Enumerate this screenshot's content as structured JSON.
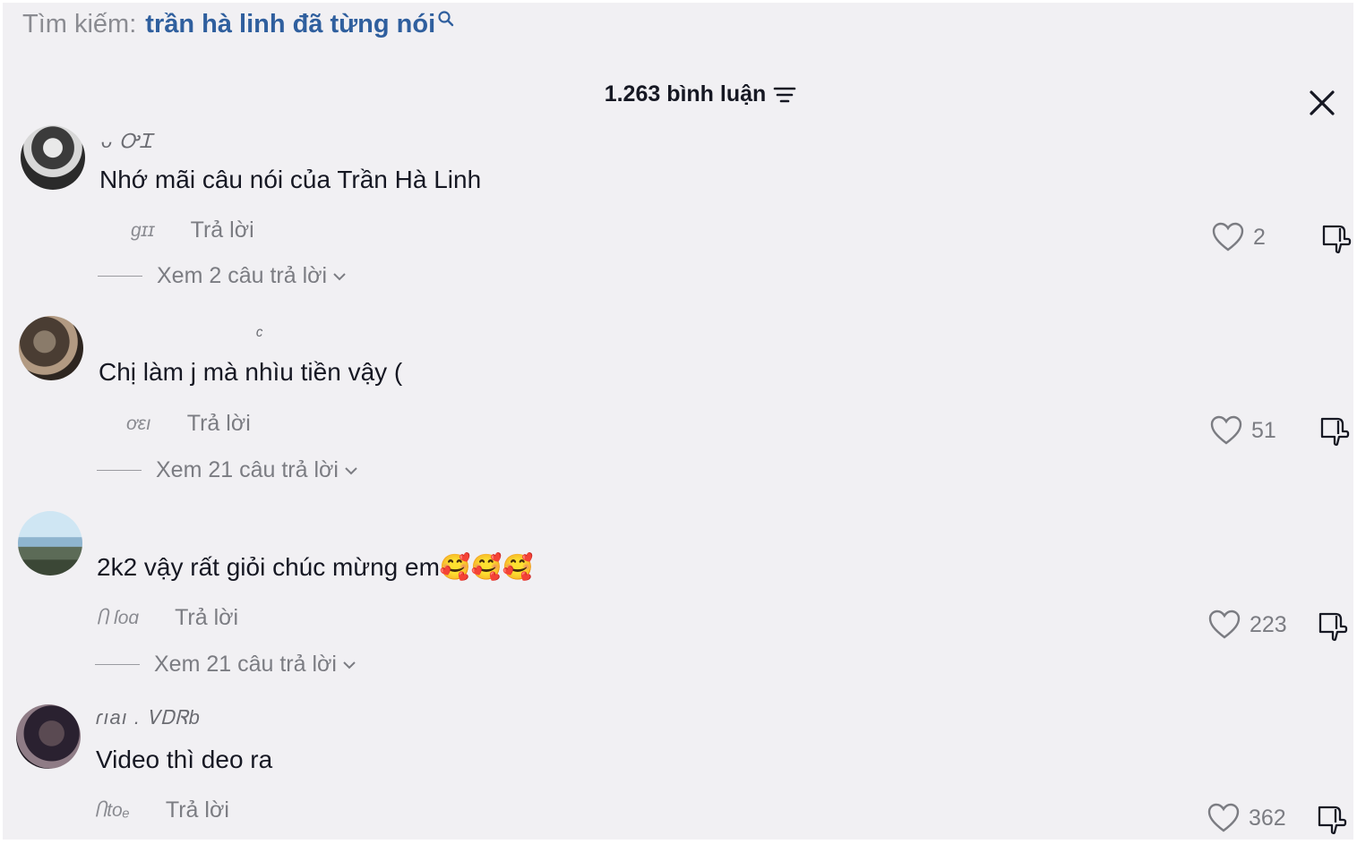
{
  "search": {
    "label": "Tìm kiếm:",
    "query": "trần hà linh đã từng nói",
    "icon": "search-icon"
  },
  "header": {
    "count_label": "1.263 bình luận",
    "sort_icon": "sort-icon",
    "close_icon": "close-icon"
  },
  "comments": [
    {
      "username": "ᴗ  ᎤᏆ",
      "text": "Nhớ mãi câu nói của Trần Hà Linh",
      "date": "ɡɪɪ",
      "reply_label": "Trả lời",
      "likes": "2",
      "view_replies_label": "Xem 2 câu trả lời"
    },
    {
      "username": "ᶜ",
      "text": "Chị làm j mà nhìu tiền vậy (",
      "date": "ơɛı",
      "reply_label": "Trả lời",
      "likes": "51",
      "view_replies_label": "Xem 21 câu trả lời"
    },
    {
      "username": "",
      "text": "2k2 vậy rất giỏi chúc mừng em🥰🥰🥰",
      "date": "Ⴖ ſoɑ",
      "reply_label": "Trả lời",
      "likes": "223",
      "view_replies_label": "Xem 21 câu trả lời"
    },
    {
      "username": "ɾıaı . ᏙᎠᏒb",
      "text": "Video thì deo ra",
      "date": "Ⴖtoₑ",
      "reply_label": "Trả lời",
      "likes": "362",
      "view_replies_label": ""
    }
  ],
  "colors": {
    "panel_bg": "#f1f0f3",
    "query_blue": "#2f5f9e",
    "text": "#161823",
    "muted": "#7b7c82"
  }
}
